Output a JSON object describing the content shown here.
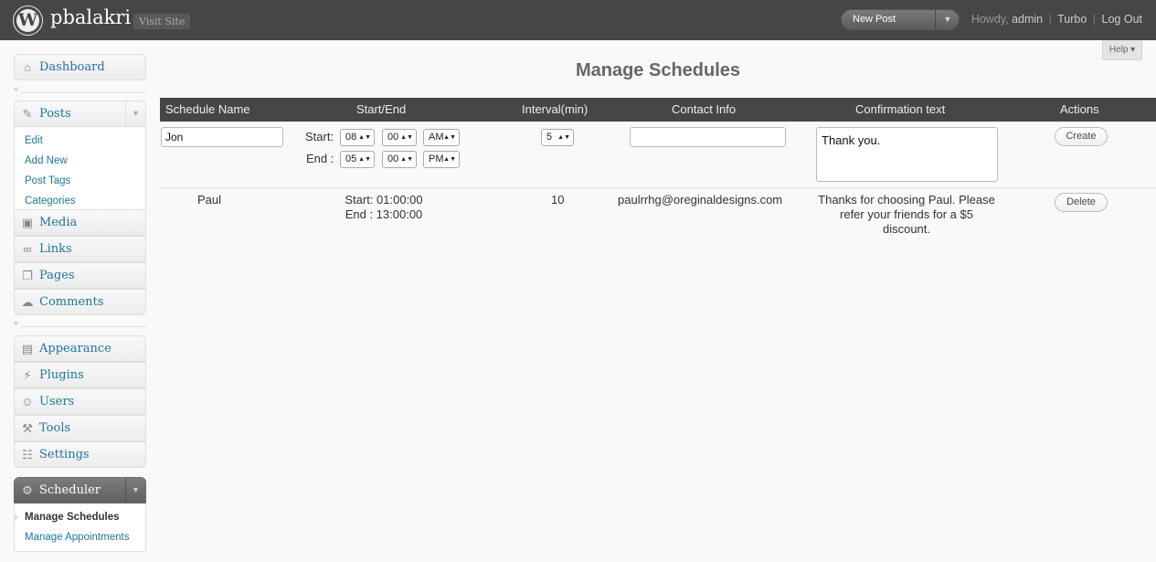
{
  "header": {
    "logo_glyph": "W",
    "site_title": "pbalakri",
    "visit_site": "Visit Site",
    "favorite_action": "New Post",
    "favorite_toggle_glyph": "▼",
    "howdy": "Howdy,",
    "user": "admin",
    "turbo": "Turbo",
    "logout": "Log Out",
    "separator": "|"
  },
  "help": "Help ▾",
  "sidebar": {
    "collapse_glyph": "«",
    "toggle_glyph": "▼",
    "dashboard": {
      "label": "Dashboard",
      "icon": "house-icon",
      "glyph": "⌂"
    },
    "posts": {
      "label": "Posts",
      "icon": "pushpin-icon",
      "glyph": "✎",
      "submenu": [
        "Edit",
        "Add New",
        "Post Tags",
        "Categories"
      ]
    },
    "media": {
      "label": "Media",
      "icon": "media-icon",
      "glyph": "▣"
    },
    "links": {
      "label": "Links",
      "icon": "link-icon",
      "glyph": "∞"
    },
    "pages": {
      "label": "Pages",
      "icon": "pages-icon",
      "glyph": "❐"
    },
    "comments": {
      "label": "Comments",
      "icon": "comment-icon",
      "glyph": "☁"
    },
    "appearance": {
      "label": "Appearance",
      "icon": "appearance-icon",
      "glyph": "▤"
    },
    "plugins": {
      "label": "Plugins",
      "icon": "plug-icon",
      "glyph": "⚡"
    },
    "users": {
      "label": "Users",
      "icon": "users-icon",
      "glyph": "☺"
    },
    "tools": {
      "label": "Tools",
      "icon": "tools-icon",
      "glyph": "⚒"
    },
    "settings": {
      "label": "Settings",
      "icon": "settings-icon",
      "glyph": "☷"
    },
    "scheduler": {
      "label": "Scheduler",
      "icon": "gear-icon",
      "glyph": "⚙",
      "submenu": [
        "Manage Schedules",
        "Manage Appointments"
      ]
    }
  },
  "page": {
    "title": "Manage Schedules",
    "columns": [
      "Schedule Name",
      "Start/End",
      "Interval(min)",
      "Contact Info",
      "Confirmation text",
      "Actions"
    ],
    "form": {
      "name_value": "Jon",
      "start_label": "Start:",
      "end_label": "End :",
      "start_hour": "08",
      "start_minute": "00",
      "start_ampm": "AM",
      "end_hour": "05",
      "end_minute": "00",
      "end_ampm": "PM",
      "interval": "5",
      "contact_value": "",
      "confirmation_value": "Thank you.",
      "create_label": "Create",
      "caret": "▲▼"
    },
    "rows": [
      {
        "name": "Paul",
        "start": "Start: 01:00:00",
        "end": "End : 13:00:00",
        "interval": "10",
        "contact": "paulrrhg@oreginaldesigns.com",
        "confirmation_lines": [
          "Thanks for choosing Paul. Please",
          "refer your friends for a $5",
          "discount."
        ],
        "delete_label": "Delete"
      }
    ]
  },
  "colors": {
    "header_bg": "#464646",
    "link": "#21759b",
    "table_head_bg": "#464646"
  }
}
